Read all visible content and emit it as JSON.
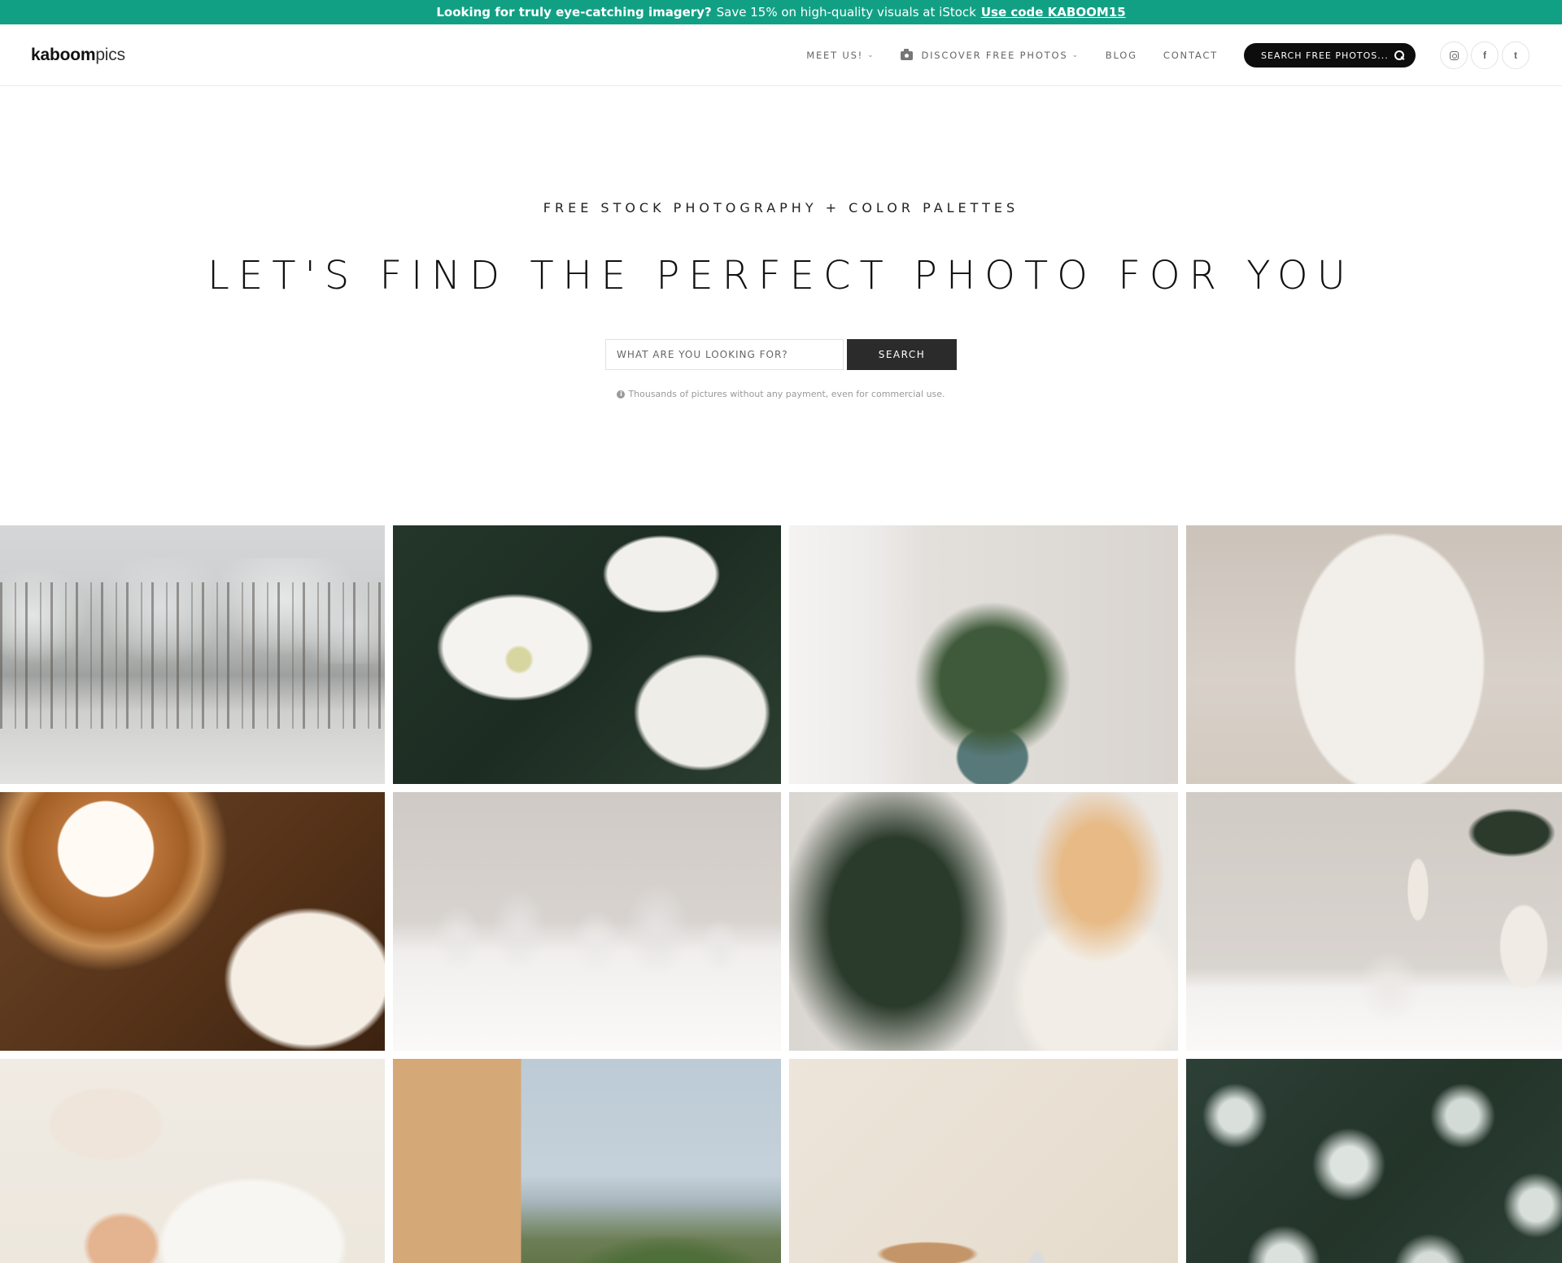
{
  "promo": {
    "headline": "Looking for truly eye-catching imagery?",
    "text": "Save 15% on high-quality visuals at iStock",
    "link": "Use code KABOOM15",
    "color": "#12a085"
  },
  "header": {
    "logo_bold": "kaboom",
    "logo_light": "pics",
    "nav": [
      {
        "label": "MEET US!",
        "has_dropdown": true
      },
      {
        "label": "DISCOVER FREE PHOTOS",
        "has_dropdown": true,
        "icon": "camera-icon"
      },
      {
        "label": "BLOG",
        "has_dropdown": false
      },
      {
        "label": "CONTACT",
        "has_dropdown": false
      }
    ],
    "search_label": "SEARCH FREE PHOTOS...",
    "social": [
      "instagram-icon",
      "facebook-icon",
      "twitter-icon"
    ],
    "facebook_glyph": "f",
    "twitter_glyph": "t"
  },
  "hero": {
    "kicker": "FREE STOCK PHOTOGRAPHY + COLOR PALETTES",
    "headline": "LET'S FIND THE PERFECT PHOTO FOR YOU",
    "search_placeholder": "WHAT ARE YOU LOOKING FOR?",
    "search_button": "SEARCH",
    "note": "Thousands of pictures without any payment, even for commercial use.",
    "info_glyph": "i"
  },
  "grid": {
    "photos": [
      {
        "subject": "snowy-forest"
      },
      {
        "subject": "white-poinsettia"
      },
      {
        "subject": "christmas-bouquet"
      },
      {
        "subject": "woman-with-candle"
      },
      {
        "subject": "bundt-cake"
      },
      {
        "subject": "glass-domes"
      },
      {
        "subject": "girl-decorating-tree"
      },
      {
        "subject": "vase-with-ornament"
      },
      {
        "subject": "person-reading-book"
      },
      {
        "subject": "coastal-villa"
      },
      {
        "subject": "bamboo-toothbrush"
      },
      {
        "subject": "frosted-leaves"
      }
    ]
  }
}
